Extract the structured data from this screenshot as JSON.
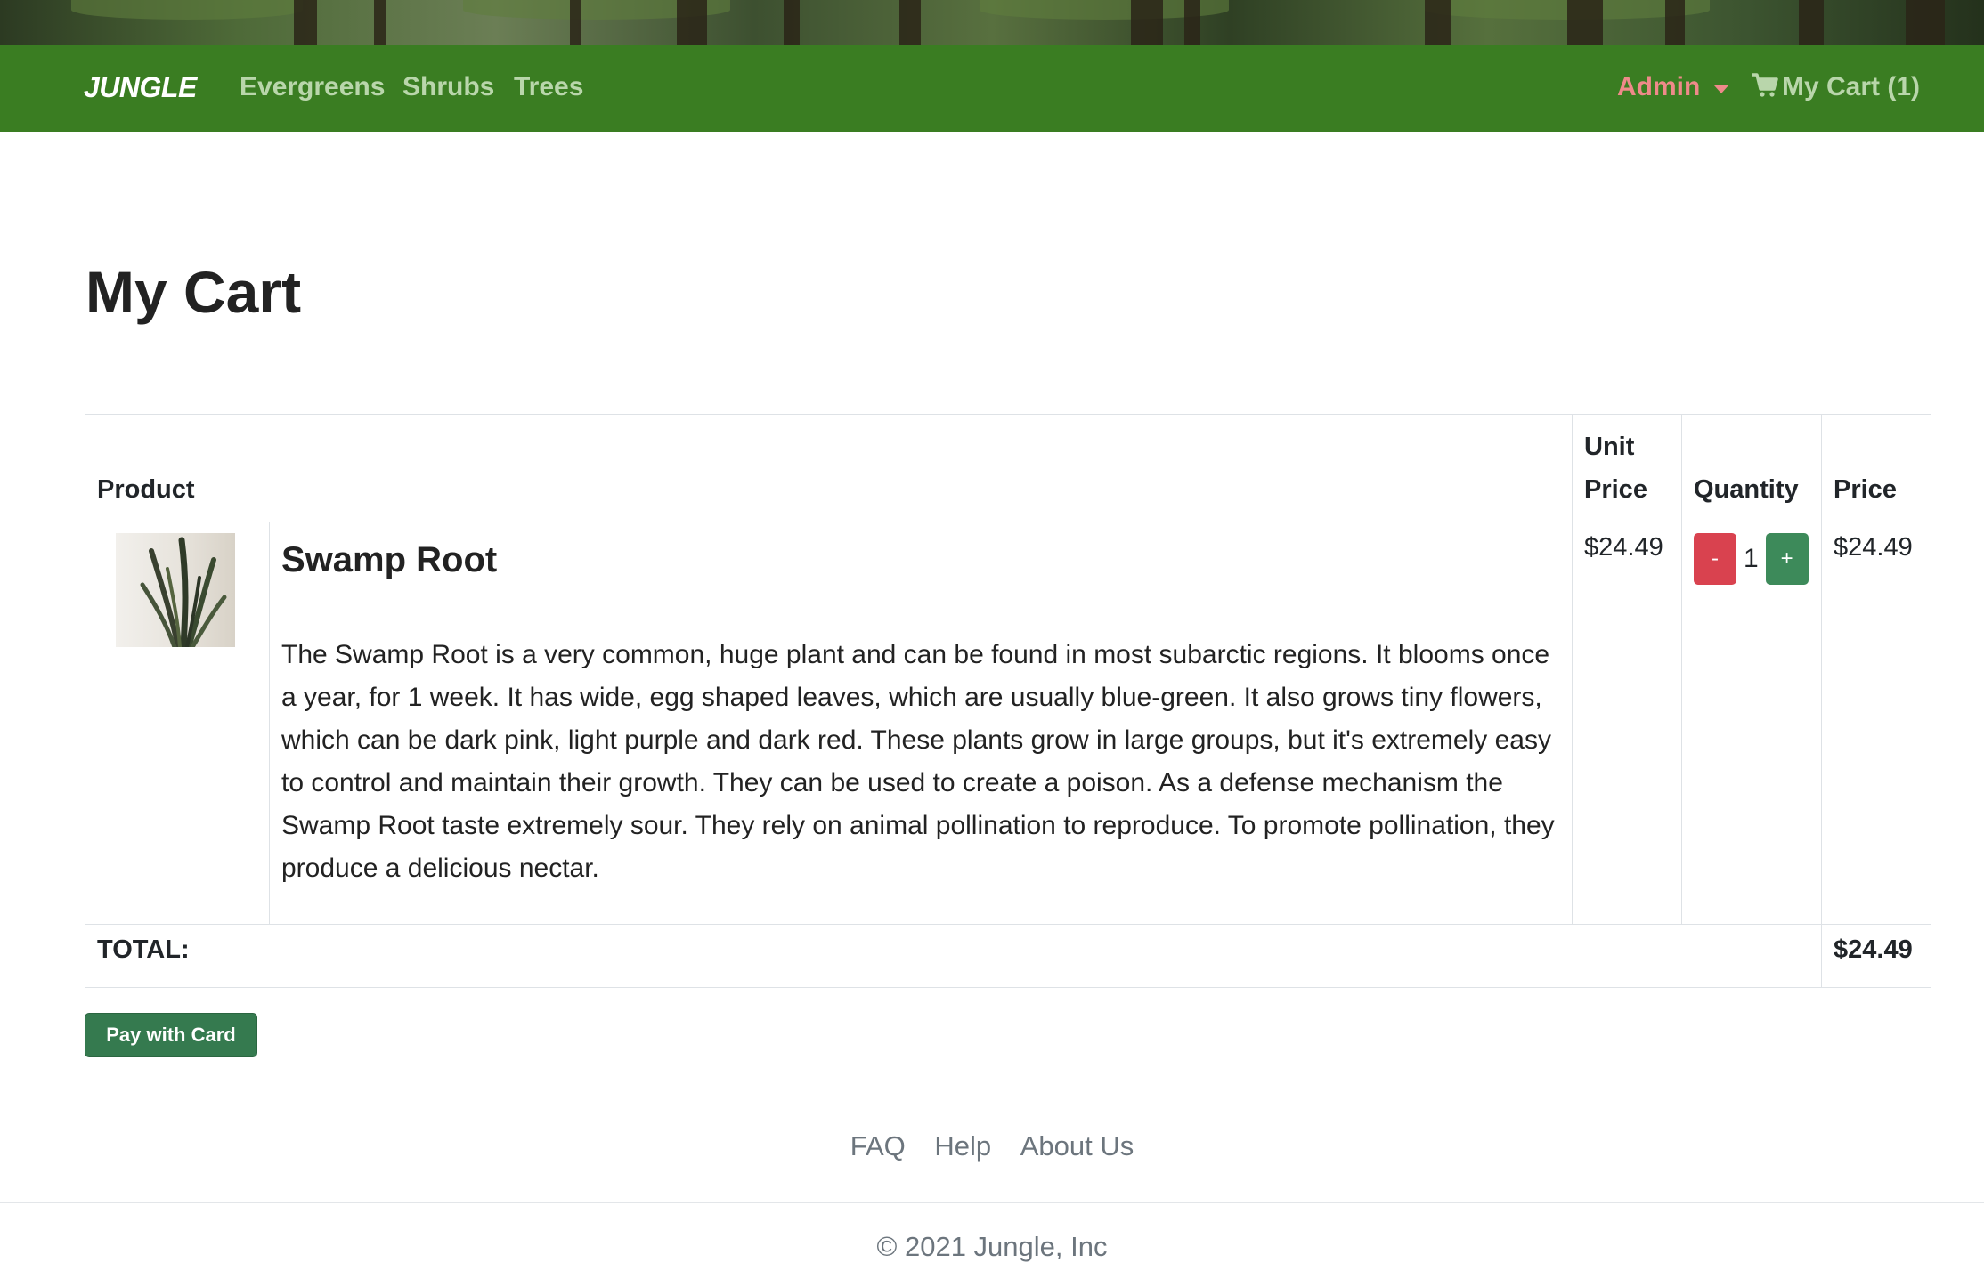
{
  "nav": {
    "brand": "JUNGLE",
    "links": [
      "Evergreens",
      "Shrubs",
      "Trees"
    ],
    "admin_label": "Admin",
    "cart_label": "My Cart (1)"
  },
  "page": {
    "title": "My Cart"
  },
  "table": {
    "headers": {
      "product": "Product",
      "unit_price": "Unit Price",
      "quantity": "Quantity",
      "price": "Price"
    },
    "items": [
      {
        "name": "Swamp Root",
        "description": "The Swamp Root is a very common, huge plant and can be found in most subarctic regions. It blooms once a year, for 1 week. It has wide, egg shaped leaves, which are usually blue-green. It also grows tiny flowers, which can be dark pink, light purple and dark red. These plants grow in large groups, but it's extremely easy to control and maintain their growth. They can be used to create a poison. As a defense mechanism the Swamp Root taste extremely sour. They rely on animal pollination to reproduce. To promote pollination, they produce a delicious nectar.",
        "unit_price": "$24.49",
        "quantity": "1",
        "minus_label": "-",
        "plus_label": "+",
        "price": "$24.49"
      }
    ],
    "total_label": "TOTAL:",
    "total_value": "$24.49"
  },
  "pay_button": "Pay with Card",
  "footer": {
    "links": [
      "FAQ",
      "Help",
      "About Us"
    ],
    "copyright": "© 2021 Jungle, Inc"
  },
  "colors": {
    "navbar": "#3a7d22",
    "admin": "#ef8a8a",
    "minus": "#d9424f",
    "plus": "#3d8a5a",
    "pay": "#357a4f"
  },
  "icons": {
    "cart": "shopping-cart-icon",
    "dropdown": "caret-down-icon"
  }
}
